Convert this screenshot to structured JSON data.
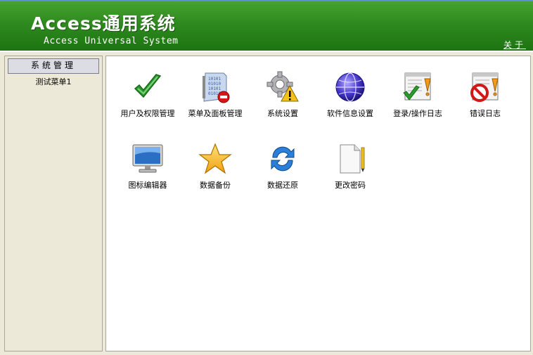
{
  "header": {
    "title": "Access通用系统",
    "subtitle": "Access Universal System",
    "about_label": "关于"
  },
  "sidebar": {
    "section_label": "系统管理",
    "items": [
      {
        "label": "测试菜单1"
      }
    ]
  },
  "main": {
    "tiles": [
      {
        "label": "用户及权限管理",
        "icon": "checkmark-icon"
      },
      {
        "label": "菜单及面板管理",
        "icon": "binary-document-icon"
      },
      {
        "label": "系统设置",
        "icon": "gear-warning-icon"
      },
      {
        "label": "软件信息设置",
        "icon": "globe-icon"
      },
      {
        "label": "登录/操作日志",
        "icon": "log-check-icon"
      },
      {
        "label": "错误日志",
        "icon": "error-log-icon"
      },
      {
        "label": "图标编辑器",
        "icon": "monitor-icon"
      },
      {
        "label": "数据备份",
        "icon": "star-icon"
      },
      {
        "label": "数据还原",
        "icon": "refresh-icon"
      },
      {
        "label": "更改密码",
        "icon": "document-pencil-icon"
      }
    ]
  },
  "colors": {
    "header_green": "#2e8a1e",
    "background": "#ece9d8",
    "panel": "#ffffff"
  }
}
